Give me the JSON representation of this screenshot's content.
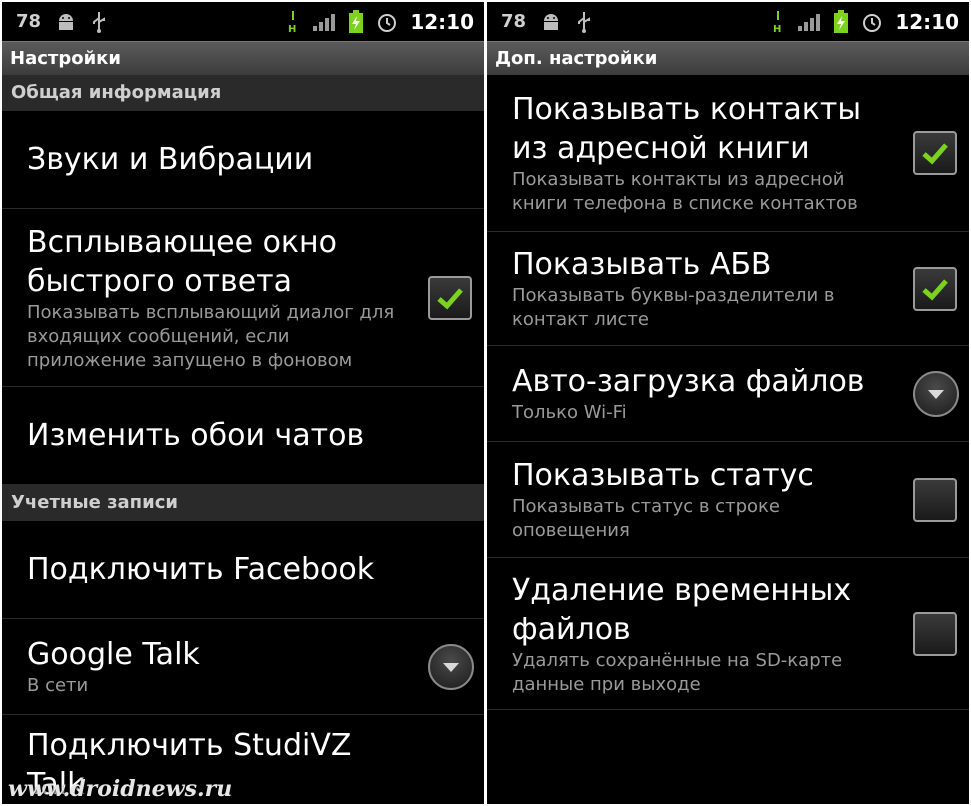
{
  "status": {
    "battery": "78",
    "time": "12:10"
  },
  "left": {
    "title": "Настройки",
    "sections": {
      "general": "Общая информация",
      "accounts": "Учетные записи"
    },
    "items": [
      {
        "title": "Звуки и Вибрации"
      },
      {
        "title1": "Всплывающее окно",
        "title2": "быстрого ответа",
        "summary1": "Показывать всплывающий диалог для",
        "summary2": "входящих сообщений, если",
        "summary3": "приложение запущено в фоновом",
        "checked": true
      },
      {
        "title": "Изменить обои чатов"
      },
      {
        "title": "Подключить Facebook"
      },
      {
        "title": "Google Talk",
        "summary": "В сети"
      },
      {
        "title": "Подключить StudiVZ Talk"
      }
    ],
    "watermark": "www.droidnews.ru"
  },
  "right": {
    "title": "Доп. настройки",
    "items": [
      {
        "title1": "Показывать контакты",
        "title2": "из адресной книги",
        "summary1": "Показывать контакты из адресной",
        "summary2": "книги телефона в списке контактов",
        "checked": true
      },
      {
        "title": "Показывать АБВ",
        "summary1": "Показывать буквы-разделители в",
        "summary2": "контакт листе",
        "checked": true
      },
      {
        "title": "Авто-загрузка файлов",
        "summary": "Только Wi-Fi"
      },
      {
        "title": "Показывать статус",
        "summary1": "Показывать статус в строке",
        "summary2": "оповещения",
        "checked": false
      },
      {
        "title1": "Удаление временных",
        "title2": "файлов",
        "summary1": "Удалять сохранённые на SD-карте",
        "summary2": "данные при выходе",
        "checked": false
      }
    ]
  },
  "icons": [
    "android-icon",
    "usb-icon",
    "hspa-icon",
    "signal-icon",
    "battery-charging-icon",
    "alarm-icon",
    "checkmark-icon",
    "dropdown-arrow-icon"
  ],
  "colors": {
    "accent_check": "#7bd31f",
    "background": "#000000",
    "titlebar": "#4a4a4a"
  }
}
